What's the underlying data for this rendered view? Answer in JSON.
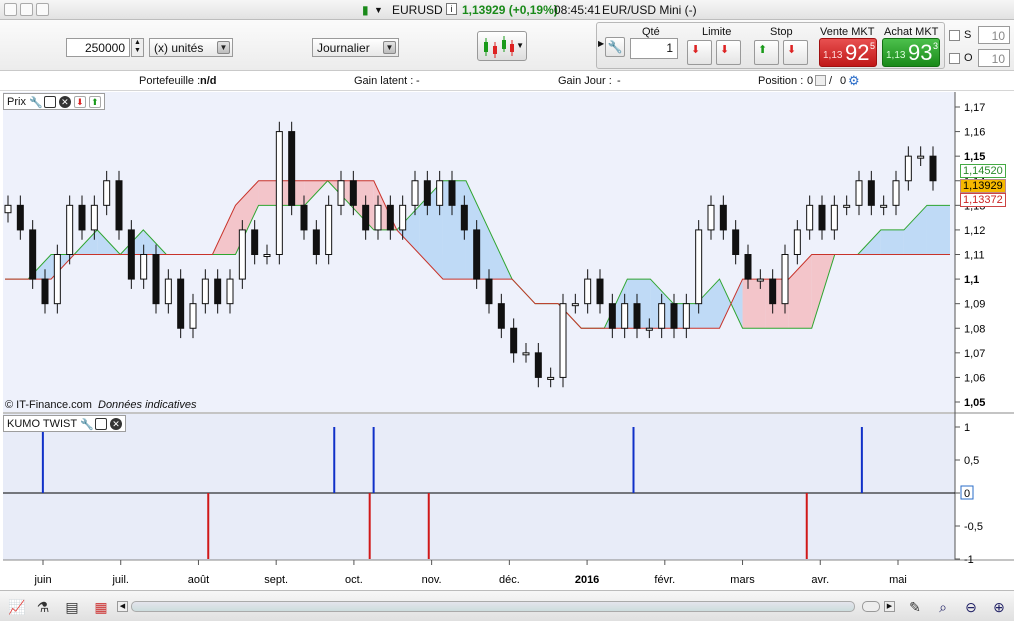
{
  "window": {
    "instrument": "EURUSD",
    "price_change": "1,13929 (+0,19%)",
    "time": "08:45:41",
    "instrument_desc": "EUR/USD Mini (-)",
    "info_icon": "i"
  },
  "toolbar": {
    "quantity_value": "250000",
    "units_label": "(x) unités",
    "period_label": "Journalier",
    "chart_style_icon": "candlestick-icon"
  },
  "order": {
    "qty_header": "Qté",
    "limit_header": "Limite",
    "stop_header": "Stop",
    "sell_header": "Vente MKT",
    "buy_header": "Achat MKT",
    "qty_value": "1",
    "sell_small": "1,13",
    "sell_big": "92",
    "sell_sup": "5",
    "buy_small": "1,13",
    "buy_big": "93",
    "buy_sup": "3",
    "s_label": "S",
    "o_label": "O",
    "s_value": "10",
    "o_value": "10"
  },
  "info": {
    "portfolio_label": "Portefeuille :",
    "portfolio_value": "n/d",
    "unrealized_label": "Gain latent :",
    "unrealized_value": "-",
    "daily_label": "Gain Jour :",
    "daily_value": "-",
    "position_label": "Position :",
    "position_value": "0",
    "position_value2": "0"
  },
  "price_panel": {
    "label": "Prix",
    "watermark_1": "© IT-Finance.com",
    "watermark_2": "Données indicatives",
    "yticks": [
      "1,17",
      "1,16",
      "1,15",
      "1,14",
      "1,13",
      "1,12",
      "1,11",
      "1,1",
      "1,09",
      "1,08",
      "1,07",
      "1,06",
      "1,05"
    ],
    "badge_green": "1,14520",
    "badge_orange": "1,13929",
    "badge_red": "1,13372"
  },
  "kumo_panel": {
    "label": "KUMO TWIST",
    "yticks": [
      "1",
      "0,5",
      "0",
      "-0,5",
      "-1"
    ]
  },
  "xaxis": {
    "labels": [
      "juin",
      "juil.",
      "août",
      "sept.",
      "oct.",
      "nov.",
      "déc.",
      "2016",
      "févr.",
      "mars",
      "avr.",
      "mai"
    ]
  },
  "chart_data": [
    {
      "type": "candlestick",
      "title": "Prix",
      "ylim": [
        1.05,
        1.17
      ],
      "last": 1.13929,
      "series": [
        {
          "name": "close",
          "values": [
            1.13,
            1.12,
            1.1,
            1.09,
            1.11,
            1.13,
            1.12,
            1.13,
            1.14,
            1.12,
            1.1,
            1.11,
            1.09,
            1.1,
            1.08,
            1.09,
            1.1,
            1.09,
            1.1,
            1.12,
            1.11,
            1.11,
            1.16,
            1.13,
            1.12,
            1.11,
            1.13,
            1.14,
            1.13,
            1.12,
            1.13,
            1.12,
            1.13,
            1.14,
            1.13,
            1.14,
            1.13,
            1.12,
            1.1,
            1.09,
            1.08,
            1.07,
            1.07,
            1.06,
            1.06,
            1.09,
            1.09,
            1.1,
            1.09,
            1.08,
            1.09,
            1.08,
            1.08,
            1.09,
            1.08,
            1.09,
            1.12,
            1.13,
            1.12,
            1.11,
            1.1,
            1.1,
            1.09,
            1.11,
            1.12,
            1.13,
            1.12,
            1.13,
            1.13,
            1.14,
            1.13,
            1.13,
            1.14,
            1.15,
            1.15,
            1.14
          ]
        }
      ],
      "cloud": {
        "span_a": [
          1.1,
          1.1,
          1.11,
          1.11,
          1.12,
          1.11,
          1.12,
          1.11,
          1.11,
          1.11,
          1.11,
          1.13,
          1.13,
          1.13,
          1.14,
          1.13,
          1.12,
          1.12,
          1.13,
          1.14,
          1.14,
          1.12,
          1.1,
          1.09,
          1.09,
          1.08,
          1.08,
          1.1,
          1.1,
          1.09,
          1.09,
          1.1,
          1.08,
          1.08,
          1.08,
          1.08,
          1.11,
          1.11,
          1.12,
          1.12,
          1.13,
          1.13
        ],
        "span_b": [
          1.1,
          1.1,
          1.1,
          1.11,
          1.11,
          1.11,
          1.11,
          1.11,
          1.11,
          1.11,
          1.13,
          1.14,
          1.14,
          1.14,
          1.14,
          1.14,
          1.14,
          1.12,
          1.11,
          1.1,
          1.1,
          1.1,
          1.1,
          1.09,
          1.09,
          1.08,
          1.08,
          1.08,
          1.08,
          1.08,
          1.08,
          1.08,
          1.1,
          1.1,
          1.1,
          1.11,
          1.11,
          1.11,
          1.11,
          1.11,
          1.11,
          1.11
        ]
      },
      "yticks": [
        1.17,
        1.16,
        1.15,
        1.14,
        1.13,
        1.12,
        1.11,
        1.1,
        1.09,
        1.08,
        1.07,
        1.06,
        1.05
      ]
    },
    {
      "type": "bar",
      "title": "KUMO TWIST",
      "ylim": [
        -1,
        1
      ],
      "events": [
        {
          "month_pos": 0.1,
          "value": 1
        },
        {
          "month_pos": 2.2,
          "value": -1
        },
        {
          "month_pos": 3.8,
          "value": 1
        },
        {
          "month_pos": 4.3,
          "value": 1
        },
        {
          "month_pos": 4.25,
          "value": -1
        },
        {
          "month_pos": 5.0,
          "value": -1
        },
        {
          "month_pos": 7.6,
          "value": 1
        },
        {
          "month_pos": 9.8,
          "value": -1
        },
        {
          "month_pos": 10.5,
          "value": 1
        }
      ]
    }
  ]
}
